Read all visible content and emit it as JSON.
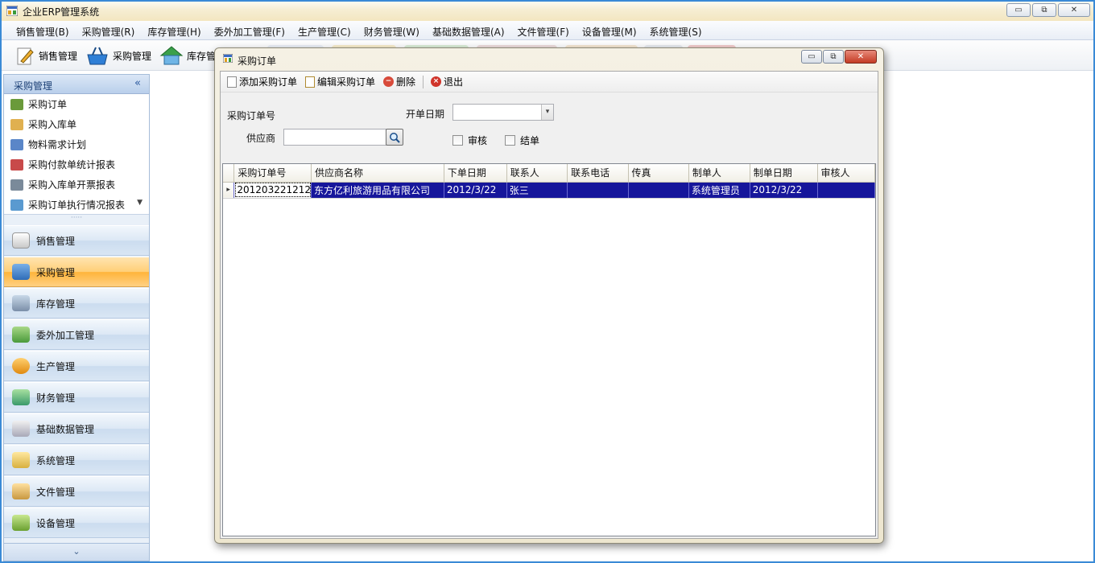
{
  "window": {
    "title": "企业ERP管理系统"
  },
  "menu": [
    "销售管理(B)",
    "采购管理(R)",
    "库存管理(H)",
    "委外加工管理(F)",
    "生产管理(C)",
    "财务管理(W)",
    "基础数据管理(A)",
    "文件管理(F)",
    "设备管理(M)",
    "系统管理(S)"
  ],
  "toolbar": {
    "sales": "销售管理",
    "purchase": "采购管理",
    "inventory": "库存管"
  },
  "sidebar": {
    "header": "采购管理",
    "collapse": "«",
    "sub_items": [
      "采购订单",
      "采购入库单",
      "物料需求计划",
      "采购付款单统计报表",
      "采购入库单开票报表",
      "采购订单执行情况报表"
    ],
    "groups": [
      "销售管理",
      "采购管理",
      "库存管理",
      "委外加工管理",
      "生产管理",
      "财务管理",
      "基础数据管理",
      "系统管理",
      "文件管理",
      "设备管理"
    ],
    "active_group": "采购管理"
  },
  "child_window": {
    "title": "采购订单",
    "toolbar": {
      "add": "添加采购订单",
      "edit": "编辑采购订单",
      "delete": "删除",
      "exit": "退出"
    },
    "form": {
      "order_no_label": "采购订单号",
      "date_label": "开单日期",
      "supplier_label": "供应商",
      "supplier_value": "",
      "audit_label": "审核",
      "closed_label": "结单"
    },
    "grid": {
      "columns": [
        "采购订单号",
        "供应商名称",
        "下单日期",
        "联系人",
        "联系电话",
        "传真",
        "制单人",
        "制单日期",
        "审核人"
      ],
      "rows": [
        [
          "201203221212",
          "东方亿利旅游用品有限公司",
          "2012/3/22",
          "张三",
          "",
          "",
          "系统管理员",
          "2012/3/22",
          ""
        ]
      ]
    }
  },
  "colors": {
    "accent": "#16169b",
    "active_group": "#ffbf55",
    "frame": "#3a8ad6"
  }
}
